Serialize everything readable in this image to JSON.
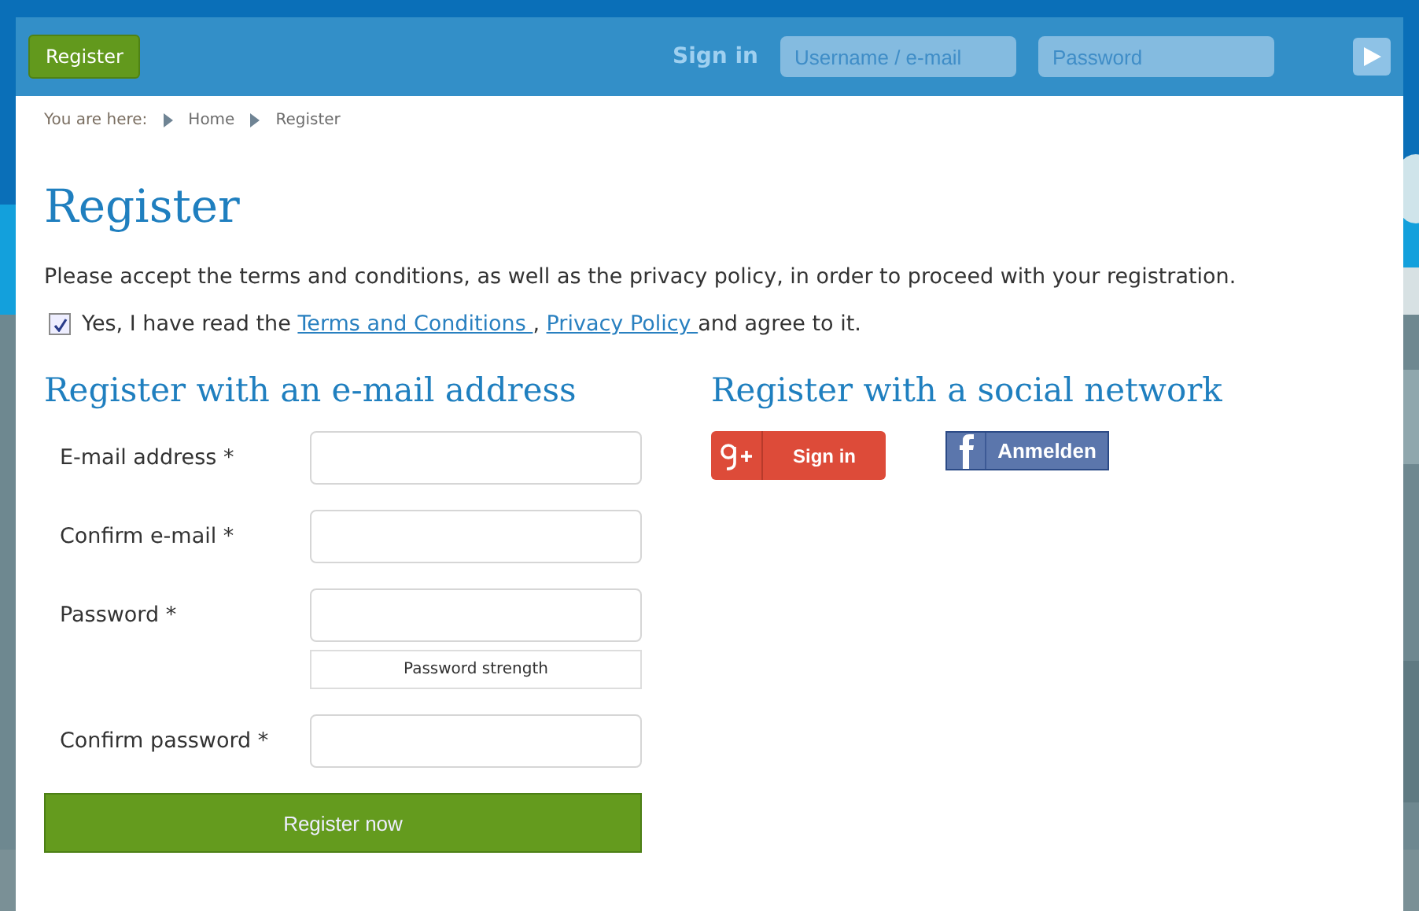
{
  "header": {
    "register_button": "Register",
    "sign_in_label": "Sign in",
    "username": {
      "placeholder": "Username / e-mail"
    },
    "password": {
      "placeholder": "Password"
    }
  },
  "breadcrumb": {
    "label": "You are here:",
    "items": [
      "Home",
      "Register"
    ]
  },
  "title": "Register",
  "intro": "Please accept the terms and conditions, as well as the privacy policy, in order to proceed with your registration.",
  "consent": {
    "checked": true,
    "prefix": "Yes, I have read the ",
    "terms_link": "Terms and Conditions ",
    "separator": ", ",
    "privacy_link": "Privacy Policy ",
    "suffix": "and agree to it."
  },
  "email_section": {
    "heading": "Register with an e-mail address",
    "fields": [
      {
        "label": "E-mail address *",
        "kind": "text"
      },
      {
        "label": "Confirm e-mail *",
        "kind": "text"
      },
      {
        "label": "Password *",
        "kind": "password",
        "strength": "Password strength"
      },
      {
        "label": "Confirm password *",
        "kind": "text"
      }
    ],
    "submit": "Register now"
  },
  "social_section": {
    "heading": "Register with a social network",
    "buttons": [
      {
        "kind": "google",
        "label": "Sign in"
      },
      {
        "kind": "facebook",
        "label": "Anmelden"
      }
    ]
  }
}
